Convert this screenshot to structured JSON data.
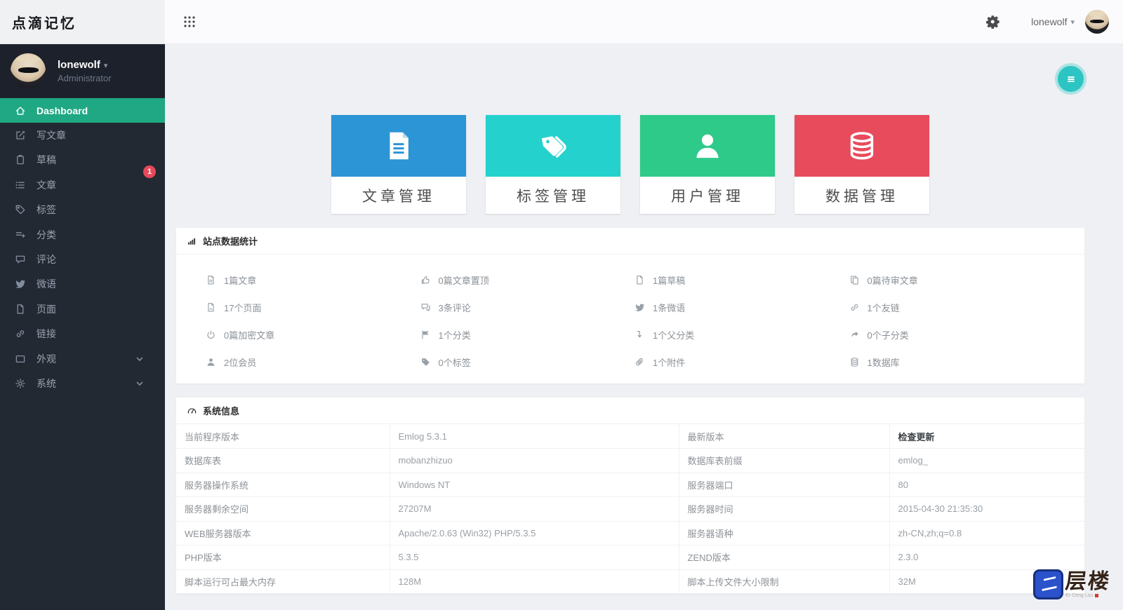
{
  "brand": {
    "title": "点滴记忆"
  },
  "topbar": {
    "username": "lonewolf"
  },
  "sidebar": {
    "user": {
      "name": "lonewolf",
      "role": "Administrator"
    },
    "items": [
      {
        "label": "Dashboard",
        "icon": "home-icon",
        "active": true
      },
      {
        "label": "写文章",
        "icon": "edit-icon"
      },
      {
        "label": "草稿",
        "icon": "clipboard-icon",
        "badge": "1"
      },
      {
        "label": "文章",
        "icon": "list-icon"
      },
      {
        "label": "标签",
        "icon": "tag-icon"
      },
      {
        "label": "分类",
        "icon": "category-icon"
      },
      {
        "label": "评论",
        "icon": "comment-icon"
      },
      {
        "label": "微语",
        "icon": "twitter-icon"
      },
      {
        "label": "页面",
        "icon": "page-icon"
      },
      {
        "label": "链接",
        "icon": "link-icon"
      },
      {
        "label": "外观",
        "icon": "appearance-icon",
        "chevron": true
      },
      {
        "label": "系统",
        "icon": "gear-icon",
        "chevron": true
      }
    ]
  },
  "cards": [
    {
      "label": "文章管理",
      "icon": "article-icon",
      "color": "#2b95d6"
    },
    {
      "label": "标签管理",
      "icon": "tags-icon",
      "color": "#24d1cd"
    },
    {
      "label": "用户管理",
      "icon": "user-icon",
      "color": "#2eca8a"
    },
    {
      "label": "数据管理",
      "icon": "database-icon",
      "color": "#e84b5c"
    }
  ],
  "stats_panel": {
    "title": "站点数据统计",
    "title_icon": "bar-chart-icon",
    "items": [
      {
        "text": "1篇文章",
        "icon": "file-text-icon"
      },
      {
        "text": "0篇文章置顶",
        "icon": "thumbs-up-icon"
      },
      {
        "text": "1篇草稿",
        "icon": "file-icon"
      },
      {
        "text": "0篇待审文章",
        "icon": "copy-icon"
      },
      {
        "text": "17个页面",
        "icon": "pages-icon"
      },
      {
        "text": "3条评论",
        "icon": "comments-icon"
      },
      {
        "text": "1条微语",
        "icon": "twitter-icon"
      },
      {
        "text": "1个友链",
        "icon": "link-icon"
      },
      {
        "text": "0篇加密文章",
        "icon": "power-icon"
      },
      {
        "text": "1个分类",
        "icon": "flag-icon"
      },
      {
        "text": "1个父分类",
        "icon": "arrow-down-icon"
      },
      {
        "text": "0个子分类",
        "icon": "share-icon"
      },
      {
        "text": "2位会员",
        "icon": "member-icon"
      },
      {
        "text": "0个标签",
        "icon": "tag-solid-icon"
      },
      {
        "text": "1个附件",
        "icon": "paperclip-icon"
      },
      {
        "text": "1数据库",
        "icon": "database-icon"
      }
    ]
  },
  "system_panel": {
    "title": "系统信息",
    "title_icon": "gauge-icon",
    "rows": [
      {
        "label1": "当前程序版本",
        "value1": "Emlog 5.3.1",
        "label2": "最新版本",
        "value2": "检查更新"
      },
      {
        "label1": "数据库表",
        "value1": "mobanzhizuo",
        "label2": "数据库表前缀",
        "value2": "emlog_"
      },
      {
        "label1": "服务器操作系统",
        "value1": "Windows NT",
        "label2": "服务器端口",
        "value2": "80"
      },
      {
        "label1": "服务器剩余空间",
        "value1": "27207M",
        "label2": "服务器时间",
        "value2": "2015-04-30 21:35:30"
      },
      {
        "label1": "WEB服务器版本",
        "value1": "Apache/2.0.63 (Win32) PHP/5.3.5",
        "label2": "服务器语种",
        "value2": "zh-CN,zh;q=0.8"
      },
      {
        "label1": "PHP版本",
        "value1": "5.3.5",
        "label2": "ZEND版本",
        "value2": "2.3.0"
      },
      {
        "label1": "脚本运行可占最大内存",
        "value1": "128M",
        "label2": "脚本上传文件大小限制",
        "value2": "32M"
      }
    ]
  },
  "watermark": {
    "text": "层楼",
    "sub": "Er Ceng Lou"
  },
  "colors": {
    "accent_green": "#1fa883",
    "fab_teal": "#2cc5c3",
    "badge_red": "#e8495a"
  }
}
